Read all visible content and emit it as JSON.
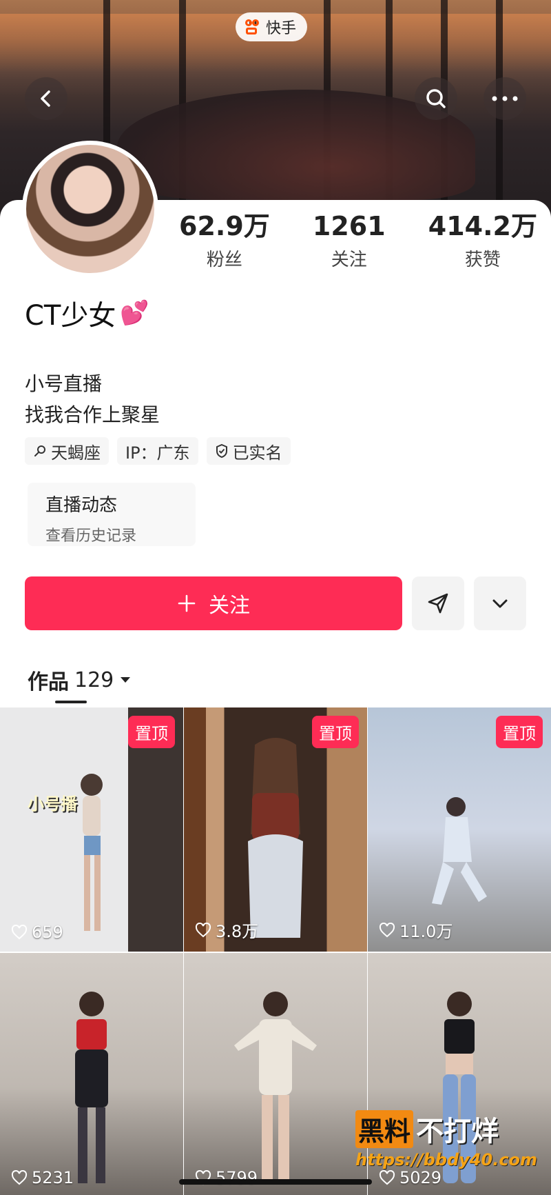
{
  "app": {
    "name": "快手"
  },
  "profile": {
    "nickname": "CT少女",
    "nickname_emoji": "💕",
    "stats": [
      {
        "value": "62.9万",
        "label": "粉丝"
      },
      {
        "value": "1261",
        "label": "关注"
      },
      {
        "value": "414.2万",
        "label": "获赞"
      }
    ],
    "bio_line1": "小号直播",
    "bio_line2": "找我合作上聚星",
    "tags": [
      {
        "icon": "pin-icon",
        "text": "天蝎座"
      },
      {
        "icon": "",
        "text": "IP：广东"
      },
      {
        "icon": "shield-check-icon",
        "text": "已实名"
      }
    ],
    "live_card": {
      "title": "直播动态",
      "subtitle": "查看历史记录"
    },
    "follow_label": "关注"
  },
  "works": {
    "tab_label": "作品",
    "count": "129",
    "items": [
      {
        "pinned": "置顶",
        "likes": "659",
        "overlay": "小号播"
      },
      {
        "pinned": "置顶",
        "likes": "3.8万",
        "overlay": ""
      },
      {
        "pinned": "置顶",
        "likes": "11.0万",
        "overlay": ""
      },
      {
        "pinned": "",
        "likes": "5231",
        "overlay": ""
      },
      {
        "pinned": "",
        "likes": "5799",
        "overlay": ""
      },
      {
        "pinned": "",
        "likes": "5029",
        "overlay": ""
      }
    ]
  },
  "watermark": {
    "brand_a": "黑料",
    "brand_b": "不打烊",
    "url": "https://bbdy40.com"
  },
  "colors": {
    "accent": "#fe2c55",
    "kuaishou_orange": "#ff5000"
  }
}
